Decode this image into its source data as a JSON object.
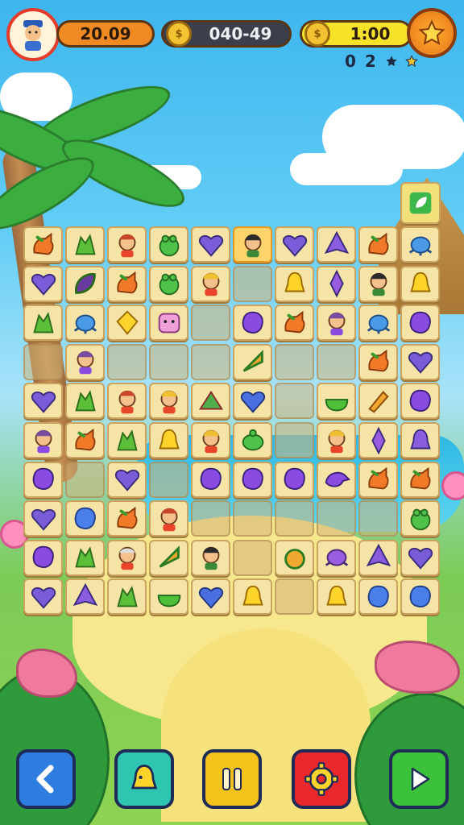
{
  "hud": {
    "timer": "20.09",
    "coins": "040-49",
    "score": "1:00",
    "stars": "0 2",
    "icons": {
      "avatar": "player-portrait-icon",
      "timer_coin": "coin-icon",
      "score_coin": "coin-icon",
      "star_button": "star-icon"
    }
  },
  "board": {
    "rows": 9,
    "cols": 10,
    "tiles": [
      [
        "fox",
        "cactus",
        "person-red",
        "frog",
        "heart-violet",
        "person-dark",
        "heart-violet",
        "gem-purple",
        "fox",
        "crab-blue"
      ],
      [
        "heart-violet",
        "leaf-purple",
        "fox",
        "frog",
        "person-blond",
        "empty",
        "bell-yellow",
        "crystal",
        "person-dark",
        "bell-yellow"
      ],
      [
        "cactus",
        "crab-blue",
        "gem-yellow",
        "monster-pink",
        "empty",
        "blob-purple",
        "fox",
        "person-purple",
        "crab-blue",
        "blob-purple"
      ],
      [
        "empty",
        "person-purple",
        "empty",
        "empty",
        "empty",
        "slice",
        "empty",
        "empty",
        "fox",
        "heart-violet"
      ],
      [
        "heart-violet",
        "cactus",
        "person-red",
        "person-blond",
        "shell",
        "heart-blue",
        "empty",
        "bowl",
        "scroll",
        "blob-purple"
      ],
      [
        "person-purple",
        "fox",
        "cactus",
        "bell-yellow",
        "person-blond",
        "turtle",
        "empty",
        "person-blond",
        "crystal",
        "bell-purple"
      ],
      [
        "blob-purple",
        "empty",
        "heart-violet",
        "empty",
        "blob-purple",
        "blob-purple",
        "blob-purple",
        "bird-purple",
        "fox",
        "fox"
      ],
      [
        "heart-violet",
        "blob-blue",
        "fox",
        "person-red",
        "empty",
        "empty",
        "empty",
        "empty",
        "empty",
        "frog"
      ],
      [
        "blob-purple",
        "cactus",
        "person-old",
        "slice",
        "person-dark",
        "empty",
        "apple",
        "crab-purple",
        "gem-purple",
        "heart-violet"
      ],
      [
        "heart-violet",
        "gem-purple",
        "cactus",
        "bowl",
        "heart-blue",
        "bell-yellow",
        "empty",
        "bell-yellow",
        "blob-blue",
        "blob-blue"
      ]
    ]
  },
  "controls": [
    {
      "name": "back-button",
      "icon": "chevron-left-icon",
      "color": "#2f7de0"
    },
    {
      "name": "hint-button",
      "icon": "bell-icon",
      "color": "#2ec6b0"
    },
    {
      "name": "pause-button",
      "icon": "pause-icon",
      "color": "#f5c21b"
    },
    {
      "name": "settings-button",
      "icon": "gear-icon",
      "color": "#e8282b"
    },
    {
      "name": "play-button",
      "icon": "play-icon",
      "color": "#3cc23a"
    }
  ],
  "colors": {
    "hud_timer": "#f08a23",
    "hud_coins": "#3a3f4b",
    "hud_score": "#f7e22a",
    "tile_face": "#f6e3a6",
    "tile_selected": "#ffd46b"
  }
}
